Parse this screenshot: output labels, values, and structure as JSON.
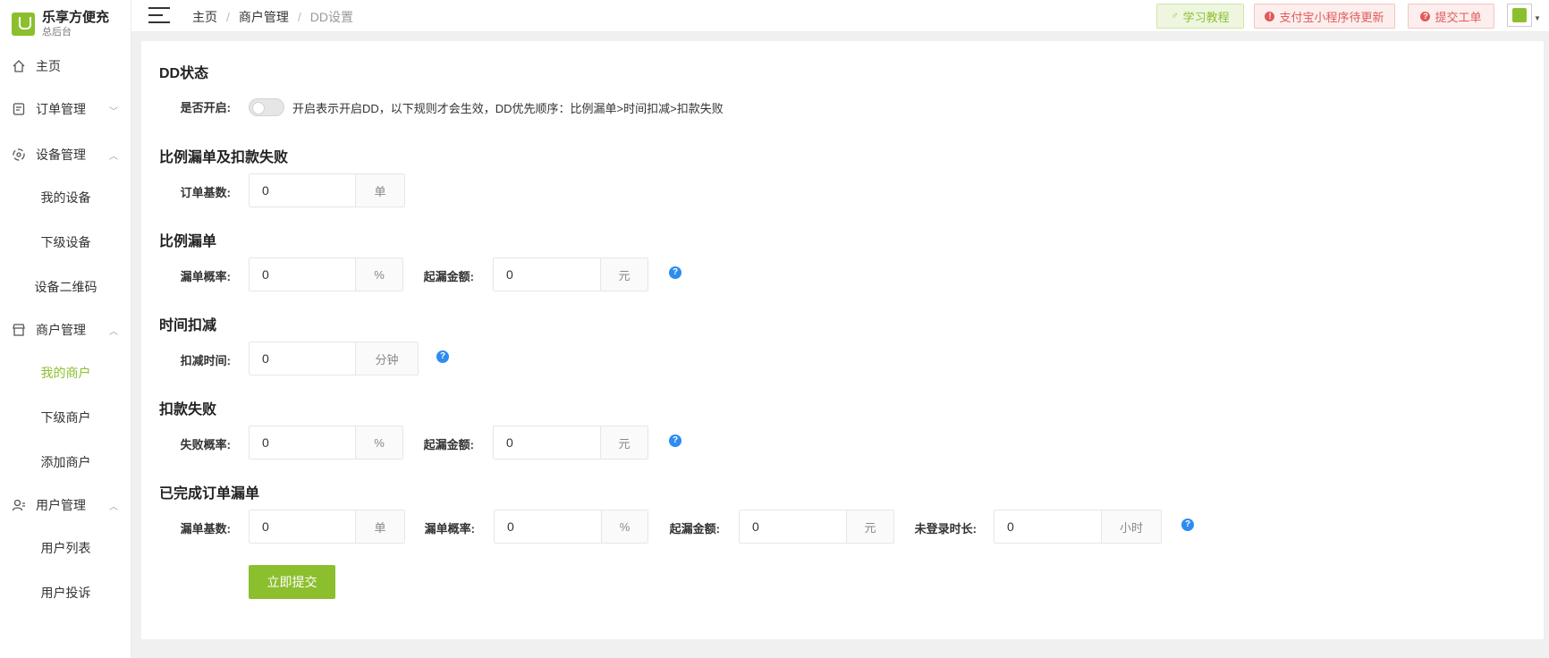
{
  "brand": {
    "name": "乐享方便充",
    "subtitle": "总后台"
  },
  "sidebar": {
    "items": [
      {
        "label": "主页"
      },
      {
        "label": "订单管理"
      },
      {
        "label": "设备管理",
        "children": [
          "我的设备",
          "下级设备",
          "设备二维码"
        ]
      },
      {
        "label": "商户管理",
        "children": [
          "我的商户",
          "下级商户",
          "添加商户"
        ]
      },
      {
        "label": "用户管理",
        "children": [
          "用户列表",
          "用户投诉"
        ]
      }
    ],
    "active": "我的商户"
  },
  "breadcrumb": [
    "主页",
    "商户管理",
    "DD设置"
  ],
  "topbar": {
    "learn": "学习教程",
    "alipay": "支付宝小程序待更新",
    "ticket": "提交工单"
  },
  "form": {
    "sec1": {
      "title": "DD状态",
      "enable_label": "是否开启:",
      "hint": "开启表示开启DD，以下规则才会生效，DD优先顺序：比例漏单>时间扣减>扣款失败"
    },
    "sec2": {
      "title": "比例漏单及扣款失败",
      "base_label": "订单基数:",
      "base_value": "0",
      "base_unit": "单"
    },
    "sec3": {
      "title": "比例漏单",
      "rate_label": "漏单概率:",
      "rate_value": "0",
      "rate_unit": "%",
      "amt_label": "起漏金额:",
      "amt_value": "0",
      "amt_unit": "元"
    },
    "sec4": {
      "title": "时间扣减",
      "time_label": "扣减时间:",
      "time_value": "0",
      "time_unit": "分钟"
    },
    "sec5": {
      "title": "扣款失败",
      "rate_label": "失败概率:",
      "rate_value": "0",
      "rate_unit": "%",
      "amt_label": "起漏金额:",
      "amt_value": "0",
      "amt_unit": "元"
    },
    "sec6": {
      "title": "已完成订单漏单",
      "base_label": "漏单基数:",
      "base_value": "0",
      "base_unit": "单",
      "rate_label": "漏单概率:",
      "rate_value": "0",
      "rate_unit": "%",
      "amt_label": "起漏金额:",
      "amt_value": "0",
      "amt_unit": "元",
      "login_label": "未登录时长:",
      "login_value": "0",
      "login_unit": "小时"
    },
    "submit": "立即提交"
  },
  "colors": {
    "accent": "#8cbf2e",
    "danger": "#e05a5a",
    "help": "#2d8cf0"
  }
}
